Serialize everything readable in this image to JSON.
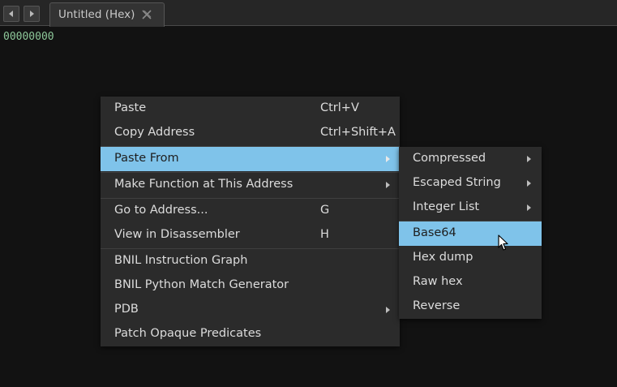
{
  "tabs": [
    {
      "label": "Untitled (Hex)",
      "close_icon": "close-icon"
    }
  ],
  "nav": {
    "back_icon": "chevron-left-icon",
    "forward_icon": "chevron-right-icon"
  },
  "editor": {
    "address": "00000000"
  },
  "context_menu": {
    "items": [
      {
        "label": "Paste",
        "shortcut": "Ctrl+V"
      },
      {
        "label": "Copy Address",
        "shortcut": "Ctrl+Shift+A"
      },
      {
        "label": "Paste From",
        "submenu": true,
        "highlighted": true
      },
      {
        "label": "Make Function at This Address",
        "submenu": true
      },
      {
        "label": "Go to Address...",
        "shortcut": "G"
      },
      {
        "label": "View in Disassembler",
        "shortcut": "H"
      },
      {
        "label": "BNIL Instruction Graph"
      },
      {
        "label": "BNIL Python Match Generator"
      },
      {
        "label": "PDB",
        "submenu": true
      },
      {
        "label": "Patch Opaque Predicates"
      }
    ]
  },
  "submenu": {
    "items": [
      {
        "label": "Compressed",
        "submenu": true
      },
      {
        "label": "Escaped String",
        "submenu": true
      },
      {
        "label": "Integer List",
        "submenu": true
      },
      {
        "label": "Base64",
        "highlighted": true
      },
      {
        "label": "Hex dump"
      },
      {
        "label": "Raw hex"
      },
      {
        "label": "Reverse"
      }
    ]
  },
  "colors": {
    "background": "#121212",
    "menu_bg": "#2b2b2b",
    "highlight": "#7fc3ea",
    "address": "#8ec89a",
    "text": "#dcdcdc"
  },
  "cursor_icon": "mouse-pointer-icon"
}
